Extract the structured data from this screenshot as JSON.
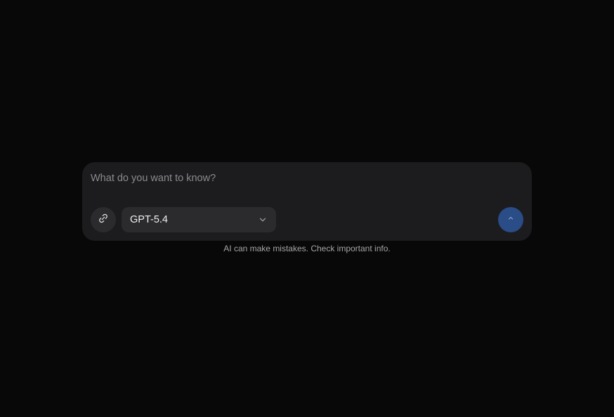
{
  "composer": {
    "placeholder": "What do you want to know?",
    "value": "",
    "model": {
      "selected": "GPT-5.4"
    },
    "send_button_color": "#2a4c87"
  },
  "icons": {
    "attach": "paperclip-icon",
    "dropdown": "chevron-down-icon",
    "send": "chevron-up-icon"
  },
  "footer": {
    "disclaimer": "AI can make mistakes. Check important info."
  }
}
